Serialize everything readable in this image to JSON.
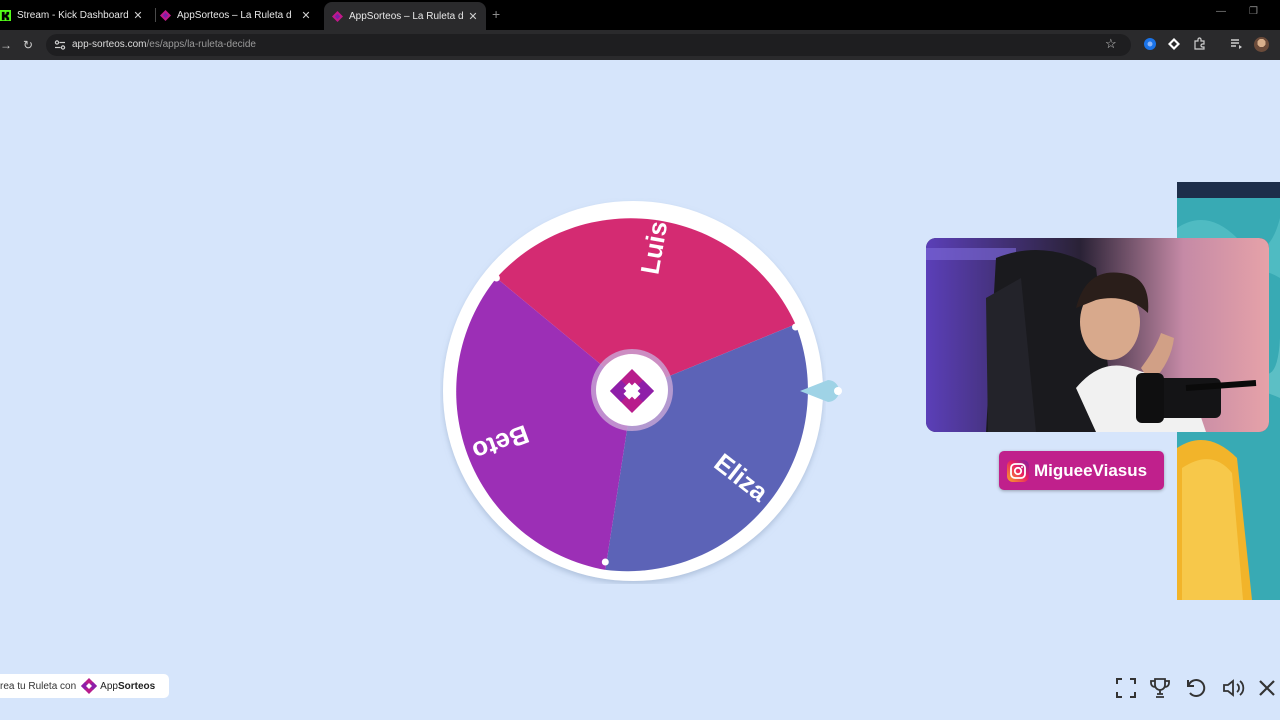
{
  "browser": {
    "tabs": [
      {
        "title": "Stream - Kick Dashboard",
        "active": false
      },
      {
        "title": "AppSorteos – La Ruleta de la Suerte",
        "active": false
      },
      {
        "title": "AppSorteos – La Ruleta de la Suerte",
        "active": true
      }
    ],
    "new_tab": "+",
    "url_host": "app-sorteos.com",
    "url_path": "/es/apps/la-ruleta-decide"
  },
  "wheel": {
    "segments": [
      {
        "label": "Luis",
        "color": "#d42b72"
      },
      {
        "label": "Eliza",
        "color": "#5c63b7"
      },
      {
        "label": "Beto",
        "color": "#9c2fb6"
      }
    ],
    "rim_color": "#ffffff",
    "center_logo": "appsorteos-logo-icon",
    "pointer_color": "#9fd3e6"
  },
  "stream": {
    "instagram_handle": "MigueeViasus",
    "instagram_icon": "instagram-icon"
  },
  "footer": {
    "credit_text": "rea tu Ruleta con",
    "brand_prefix": "App",
    "brand_suffix": "Sorteos"
  },
  "controls": [
    {
      "name": "fullscreen-icon"
    },
    {
      "name": "trophy-icon"
    },
    {
      "name": "undo-icon"
    },
    {
      "name": "volume-icon"
    },
    {
      "name": "close-icon"
    }
  ]
}
